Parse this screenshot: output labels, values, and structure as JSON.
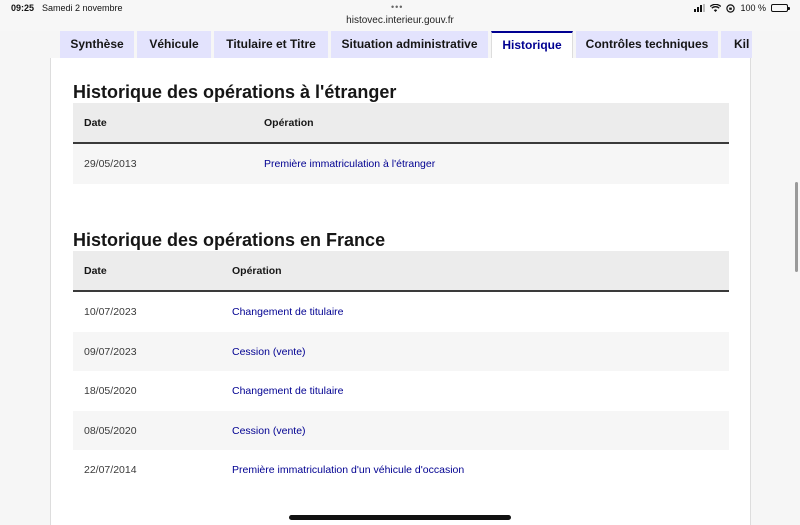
{
  "status_bar": {
    "time": "09:25",
    "date": "Samedi 2 novembre",
    "url": "histovec.interieur.gouv.fr",
    "battery": "100 %"
  },
  "tabs": [
    {
      "label": "Synthèse",
      "active": false
    },
    {
      "label": "Véhicule",
      "active": false
    },
    {
      "label": "Titulaire et Titre",
      "active": false
    },
    {
      "label": "Situation administrative",
      "active": false
    },
    {
      "label": "Historique",
      "active": true
    },
    {
      "label": "Contrôles techniques",
      "active": false
    },
    {
      "label": "Kil",
      "active": false
    }
  ],
  "foreign": {
    "title": "Historique des opérations à l'étranger",
    "headers": {
      "date": "Date",
      "operation": "Opération"
    },
    "rows": [
      {
        "date": "29/05/2013",
        "operation": "Première immatriculation à l'étranger"
      }
    ]
  },
  "france": {
    "title": "Historique des opérations en France",
    "headers": {
      "date": "Date",
      "operation": "Opération"
    },
    "rows": [
      {
        "date": "10/07/2023",
        "operation": "Changement de titulaire"
      },
      {
        "date": "09/07/2023",
        "operation": "Cession (vente)"
      },
      {
        "date": "18/05/2020",
        "operation": "Changement de titulaire"
      },
      {
        "date": "08/05/2020",
        "operation": "Cession (vente)"
      },
      {
        "date": "22/07/2014",
        "operation": "Première immatriculation d'un véhicule d'occasion"
      }
    ]
  }
}
